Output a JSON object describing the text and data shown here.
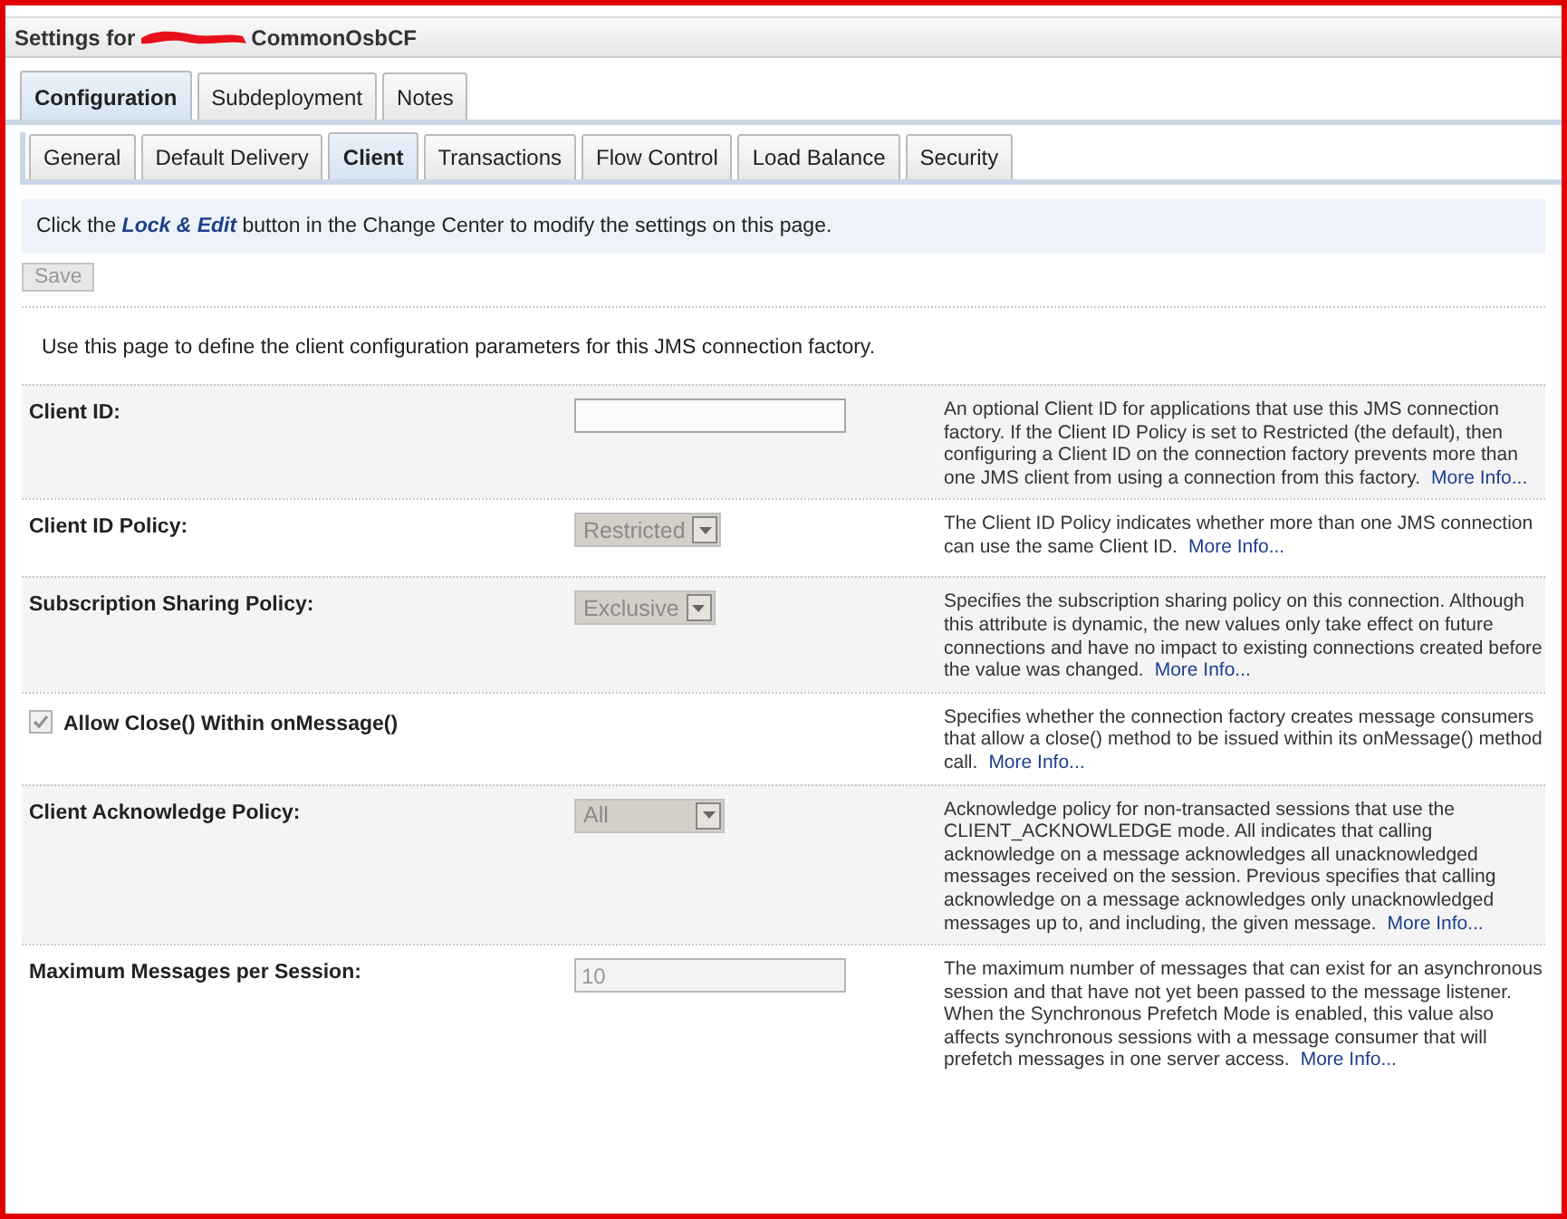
{
  "title": {
    "prefix": "Settings for",
    "name": "CommonOsbCF"
  },
  "tabs": [
    {
      "label": "Configuration",
      "selected": true
    },
    {
      "label": "Subdeployment",
      "selected": false
    },
    {
      "label": "Notes",
      "selected": false
    }
  ],
  "subtabs": [
    {
      "label": "General",
      "selected": false
    },
    {
      "label": "Default Delivery",
      "selected": false
    },
    {
      "label": "Client",
      "selected": true
    },
    {
      "label": "Transactions",
      "selected": false
    },
    {
      "label": "Flow Control",
      "selected": false
    },
    {
      "label": "Load Balance",
      "selected": false
    },
    {
      "label": "Security",
      "selected": false
    }
  ],
  "notice": "Click the **Lock & Edit** button in the Change Center to modify the settings on this page.",
  "save_button": {
    "label": "Save",
    "disabled": true
  },
  "intro": "Use this page to define the client configuration parameters for this JMS connection factory.",
  "rows": [
    {
      "kind": "text",
      "label": "Client ID:",
      "value": "",
      "disabled": false,
      "help": "An optional Client ID for applications that use this JMS connection factory. If the Client ID Policy is set to Restricted (the default), then configuring a Client ID on the connection factory prevents more than one JMS client from using a connection from this factory.",
      "more_info": "More Info..."
    },
    {
      "kind": "select",
      "label": "Client ID Policy:",
      "value": "Restricted",
      "disabled": true,
      "help": "The Client ID Policy indicates whether more than one JMS connection can use the same Client ID.",
      "more_info": "More Info..."
    },
    {
      "kind": "select",
      "label": "Subscription Sharing Policy:",
      "value": "Exclusive",
      "disabled": true,
      "help": "Specifies the subscription sharing policy on this connection. Although this attribute is dynamic, the new values only take effect on future connections and have no impact to existing connections created before the value was changed.",
      "more_info": "More Info..."
    },
    {
      "kind": "checkbox",
      "label": "Allow Close() Within onMessage()",
      "checked": true,
      "disabled": true,
      "help": "Specifies whether the connection factory creates message consumers that allow a close() method to be issued within its onMessage() method call.",
      "more_info": "More Info..."
    },
    {
      "kind": "select",
      "label": "Client Acknowledge Policy:",
      "value": "All",
      "disabled": true,
      "help": "Acknowledge policy for non-transacted sessions that use the CLIENT_ACKNOWLEDGE mode. All indicates that calling acknowledge on a message acknowledges all unacknowledged messages received on the session. Previous specifies that calling acknowledge on a message acknowledges only unacknowledged messages up to, and including, the given message.",
      "more_info": "More Info..."
    },
    {
      "kind": "text",
      "label": "Maximum Messages per Session:",
      "value": "10",
      "disabled": true,
      "help": "The maximum number of messages that can exist for an asynchronous session and that have not yet been passed to the message listener. When the Synchronous Prefetch Mode is enabled, this value also affects synchronous sessions with a message consumer that will prefetch messages in one server access.",
      "more_info": "More Info..."
    }
  ]
}
